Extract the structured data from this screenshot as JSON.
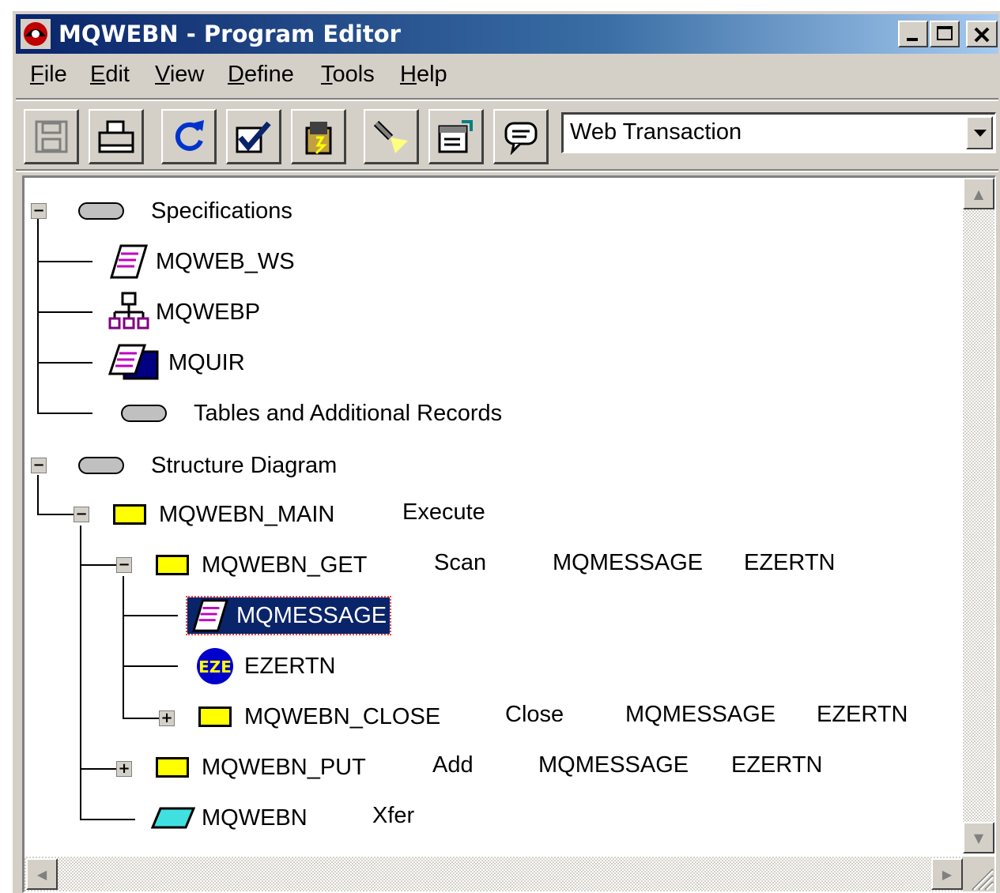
{
  "window": {
    "title": "MQWEBN - Program Editor"
  },
  "menu": [
    {
      "pre": "",
      "key": "F",
      "rest": "ile"
    },
    {
      "pre": "",
      "key": "E",
      "rest": "dit"
    },
    {
      "pre": "",
      "key": "V",
      "rest": "iew"
    },
    {
      "pre": "",
      "key": "D",
      "rest": "efine"
    },
    {
      "pre": "",
      "key": "T",
      "rest": "ools"
    },
    {
      "pre": "",
      "key": "H",
      "rest": "elp"
    }
  ],
  "toolbar": {
    "icons": [
      "save-icon",
      "print-icon",
      "refresh-icon",
      "validate-icon",
      "clipboard-icon",
      "flashlight-icon",
      "properties-icon",
      "comment-icon"
    ],
    "combo_value": "Web Transaction"
  },
  "tree": {
    "specifications": "Specifications",
    "mqweb_ws": "MQWEB_WS",
    "mqwebp": "MQWEBP",
    "mquir": "MQUIR",
    "tables": "Tables and Additional Records",
    "structure": "Structure Diagram",
    "main": {
      "name": "MQWEBN_MAIN",
      "c1": "Execute"
    },
    "get": {
      "name": "MQWEBN_GET",
      "c1": "Scan",
      "c2": "MQMESSAGE",
      "c3": "EZERTN"
    },
    "mqmessage": "MQMESSAGE",
    "ezertn": "EZERTN",
    "ezertn_icon": "EZE",
    "close": {
      "name": "MQWEBN_CLOSE",
      "c1": "Close",
      "c2": "MQMESSAGE",
      "c3": "EZERTN"
    },
    "put": {
      "name": "MQWEBN_PUT",
      "c1": "Add",
      "c2": "MQMESSAGE",
      "c3": "EZERTN"
    },
    "xfer": {
      "name": "MQWEBN",
      "c1": "Xfer"
    }
  },
  "colors": {
    "title_start": "#0a246a",
    "title_end": "#a6caf0",
    "selection": "#0a246a",
    "process": "#ffff00",
    "xfer": "#40e0e0"
  }
}
